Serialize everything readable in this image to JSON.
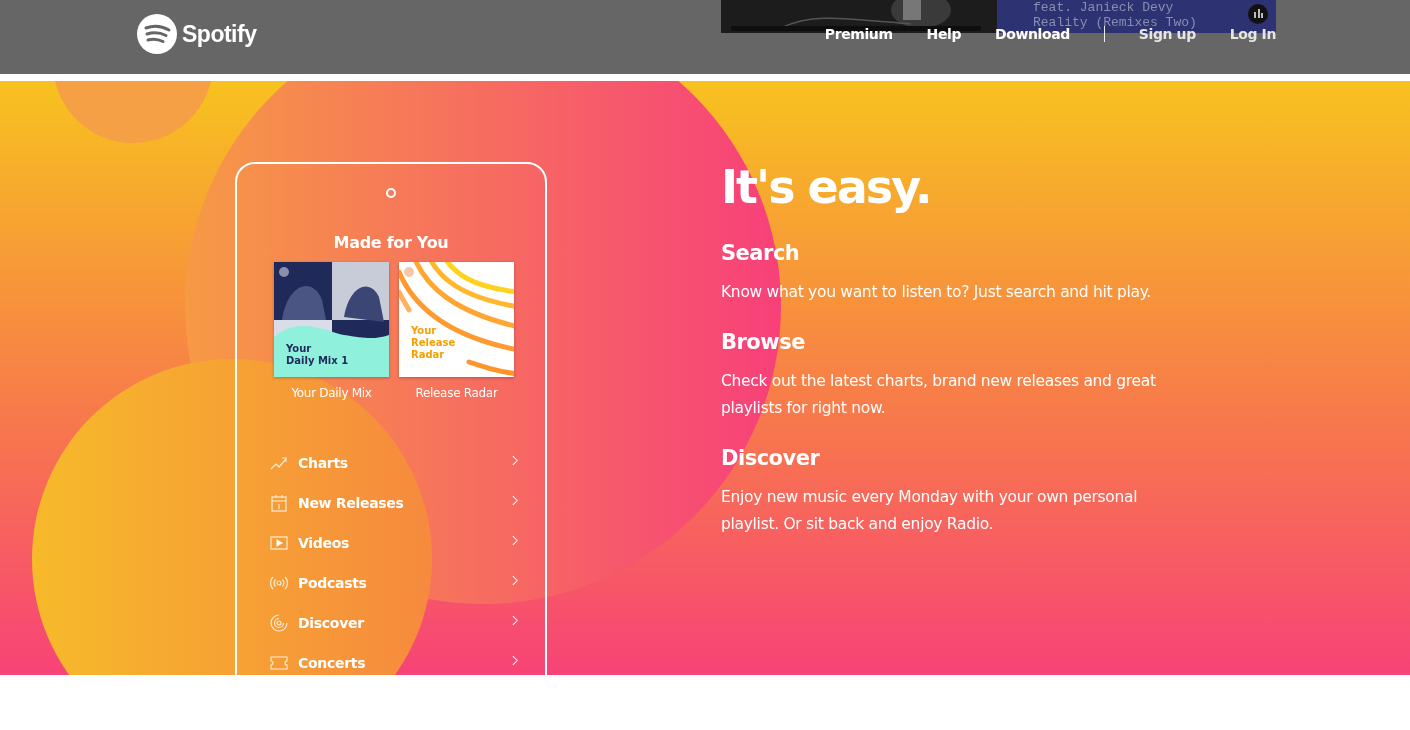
{
  "header": {
    "logo_text": "Spotify",
    "player": {
      "line_1": "feat. Janieck Devy",
      "line_2": "Reality (Remixes Two)"
    },
    "nav": [
      {
        "label": "Premium",
        "kind": "primary"
      },
      {
        "label": "Help",
        "kind": "primary"
      },
      {
        "label": "Download",
        "kind": "primary"
      },
      {
        "label": "Sign up",
        "kind": "account"
      },
      {
        "label": "Log In",
        "kind": "account"
      }
    ]
  },
  "phone": {
    "heading": "Made for You",
    "playlists": [
      {
        "cover_title": "Your\nDaily Mix 1",
        "caption": "Your Daily Mix",
        "kind": "mix"
      },
      {
        "cover_title": "Your\nRelease\nRadar",
        "caption": "Release Radar",
        "kind": "radar"
      }
    ],
    "menu": [
      {
        "label": "Charts",
        "kind": "charts"
      },
      {
        "label": "New Releases",
        "kind": "calendar"
      },
      {
        "label": "Videos",
        "kind": "video"
      },
      {
        "label": "Podcasts",
        "kind": "podcast"
      },
      {
        "label": "Discover",
        "kind": "discover"
      },
      {
        "label": "Concerts",
        "kind": "ticket"
      }
    ]
  },
  "features": {
    "title": "It's easy.",
    "sections": [
      {
        "heading": "Search",
        "text": "Know what you want to listen to? Just search and hit play."
      },
      {
        "heading": "Browse",
        "text": "Check out the latest charts, brand new releases and great playlists for right now."
      },
      {
        "heading": "Discover",
        "text": "Enjoy new music every Monday with your own personal playlist. Or sit back and enjoy Radio."
      }
    ]
  }
}
